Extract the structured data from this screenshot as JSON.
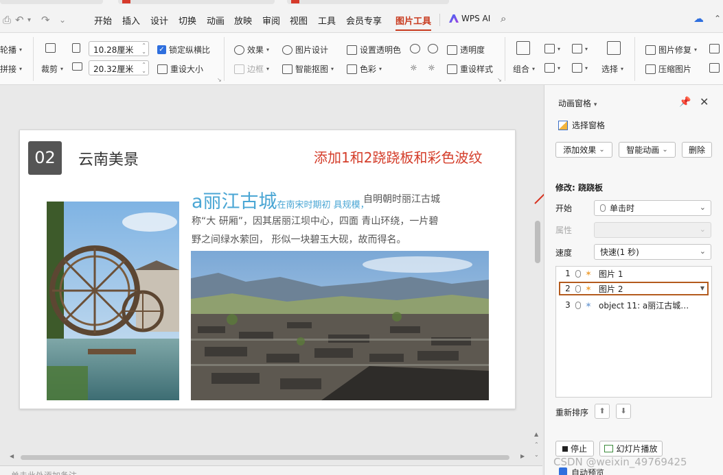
{
  "menu_tabs": [
    "开始",
    "插入",
    "设计",
    "切换",
    "动画",
    "放映",
    "审阅",
    "视图",
    "工具",
    "会员专享",
    "图片工具"
  ],
  "wps_ai": "WPS AI",
  "ribbon": {
    "lunbo": "轮播",
    "pinjie": "拼接",
    "caijian": "裁剪",
    "width": "10.28厘米",
    "height": "20.32厘米",
    "lock_ratio": "锁定纵横比",
    "resize": "重设大小",
    "effect": "效果",
    "border": "边框",
    "pic_design": "图片设计",
    "smart_cutout": "智能抠图",
    "set_transparent": "设置透明色",
    "color": "色彩",
    "transparency": "透明度",
    "reset_style": "重设样式",
    "combine": "组合",
    "select": "选择",
    "pic_repair": "图片修复",
    "compress": "压缩图片"
  },
  "slide": {
    "number": "02",
    "title": "云南美景",
    "note": "添加1和2跷跷板和彩色波纹",
    "heading": "a丽江古城",
    "heading_small": "在南宋时期初 具规模，",
    "para1_tail": "自明朝时丽江古城",
    "para2": "称“大 研厢”，因其居丽江坝中心，四面 青山环绕，一片碧",
    "para3": "野之间绿水萦回， 形似一块碧玉大砚，故而得名。"
  },
  "notes_placeholder": "单击此处添加备注",
  "pane": {
    "title": "动画窗格",
    "select_pane": "选择窗格",
    "add_effect": "添加效果",
    "smart_anim": "智能动画",
    "delete": "删除",
    "modify": "修改: 跷跷板",
    "start_label": "开始",
    "start_value": "单击时",
    "property_label": "属性",
    "speed_label": "速度",
    "speed_value": "快速(1 秒)",
    "items": [
      {
        "no": "1",
        "name": "图片 1"
      },
      {
        "no": "2",
        "name": "图片 2"
      },
      {
        "no": "3",
        "name": "object 11: a丽江古城在..."
      }
    ],
    "reorder": "重新排序",
    "stop": "停止",
    "slideshow": "幻灯片播放",
    "auto_preview": "自动预览"
  },
  "watermark": "CSDN @weixin_49769425",
  "colors": {
    "accent_red": "#d43d2a",
    "accent_blue": "#4aa6d4",
    "selected_border": "#b35a1c"
  }
}
